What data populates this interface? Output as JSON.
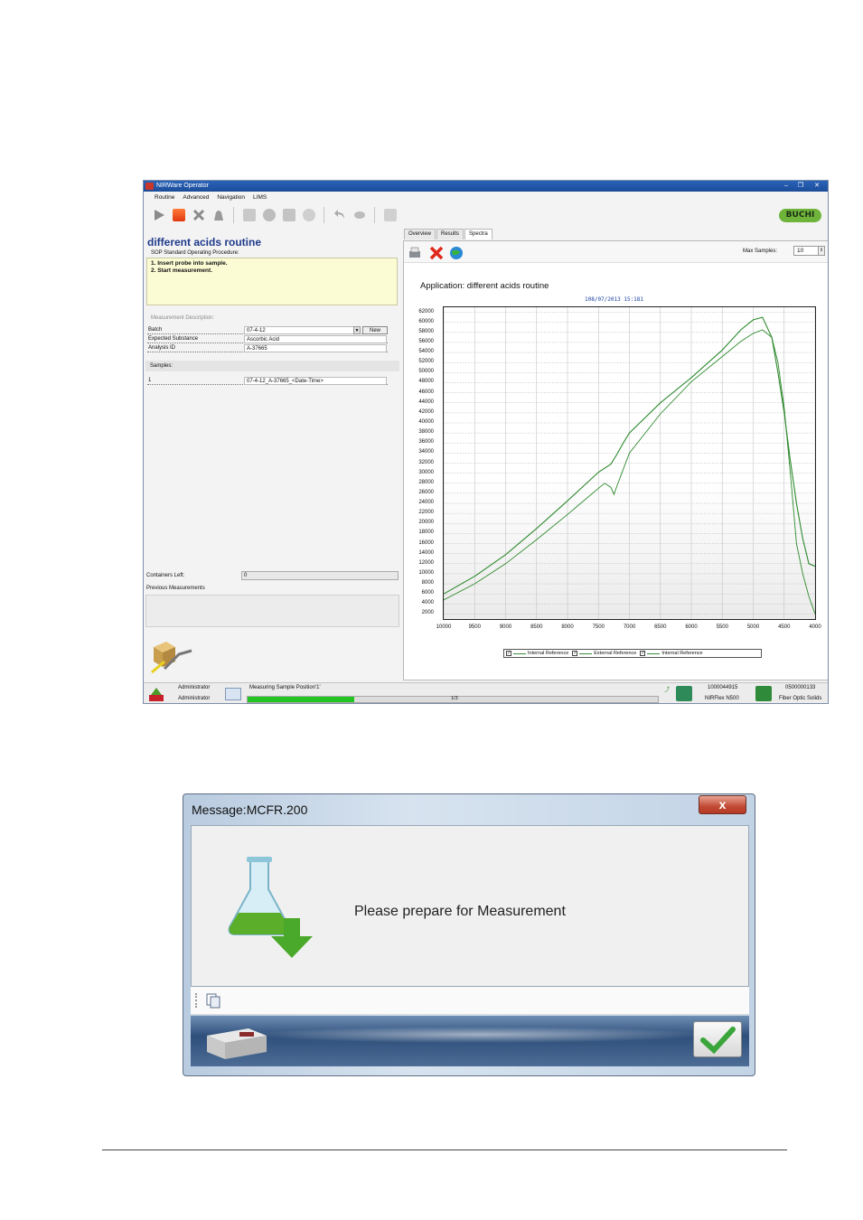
{
  "main_window": {
    "title": "NIRWare Operator",
    "menu": [
      "Routine",
      "Advanced",
      "Navigation",
      "LIMS"
    ],
    "logo_text": "BUCHI",
    "routine_title": "different acids routine",
    "sop_label": "SOP Standard Operating Procedure:",
    "sop_steps": [
      "1. Insert probe into sample.",
      "2. Start measurement."
    ],
    "measurement_description_label": "Measurement Description:",
    "fields": [
      {
        "label": "Batch",
        "value": "07-4-12"
      },
      {
        "label": "Expected Substance",
        "value": "Ascorbic Acid"
      },
      {
        "label": "Analysis ID",
        "value": "A-37665"
      }
    ],
    "new_button_label": "New",
    "samples_label": "Samples:",
    "sample_row": {
      "index": "1",
      "value": "07-4-12_A-37665_<Date-Time>"
    },
    "containers_left_label": "Containers Left:",
    "containers_left_value": "0",
    "previous_measurements_label": "Previous Measurements",
    "tabs": [
      "Overview",
      "Results",
      "Spectra"
    ],
    "active_tab": "Spectra",
    "max_samples_label": "Max Samples:",
    "max_samples_value": "10",
    "status": {
      "user_top": "Administrator",
      "user_bottom": "Administrator",
      "measuring_text": "Measuring Sample Position'1'",
      "progress_text": "1/3",
      "progress": 0.26,
      "device_id": "1000044915",
      "device_name": "NIRFlex N500",
      "cell_id": "0500000133",
      "cell_name": "Fiber Optic Solids"
    }
  },
  "chart_data": {
    "type": "line",
    "title": "Application: different acids routine",
    "subtitle": "108/07/2013 15:181",
    "x_ticks": [
      "10000",
      "9500",
      "9000",
      "8500",
      "8000",
      "7500",
      "7000",
      "6500",
      "6000",
      "5500",
      "5000",
      "4500",
      "4000"
    ],
    "y_ticks": [
      "62000",
      "60000",
      "58000",
      "56000",
      "54000",
      "52000",
      "50000",
      "48000",
      "46000",
      "44000",
      "42000",
      "40000",
      "38000",
      "36000",
      "34000",
      "32000",
      "30000",
      "28000",
      "26000",
      "24000",
      "22000",
      "20000",
      "18000",
      "16000",
      "14000",
      "12000",
      "10000",
      "8000",
      "6000",
      "4000",
      "2000"
    ],
    "xlim": [
      10000,
      4000
    ],
    "ylim": [
      1000,
      63000
    ],
    "series": [
      {
        "name": "Internal Reference",
        "x": [
          10000,
          9500,
          9000,
          8500,
          8000,
          7500,
          7300,
          7200,
          7100,
          7000,
          6500,
          6000,
          5500,
          5200,
          5000,
          4850,
          4700,
          4600,
          4500,
          4400,
          4300,
          4200,
          4100,
          4000
        ],
        "y": [
          6000,
          9500,
          13800,
          19000,
          24500,
          30200,
          31800,
          33800,
          36000,
          38000,
          44000,
          49000,
          54500,
          58500,
          60500,
          61000,
          57000,
          50000,
          42000,
          32500,
          24000,
          17000,
          12000,
          11500
        ]
      },
      {
        "name": "External Reference",
        "x": [
          10000,
          9500,
          9000,
          8500,
          8000,
          7500,
          7400,
          7300,
          7250,
          7200,
          7100,
          7000,
          6500,
          6000,
          5500,
          5200,
          5000,
          4850,
          4700,
          4600,
          4500,
          4400,
          4300,
          4200,
          4100,
          4000
        ],
        "y": [
          4800,
          8000,
          12000,
          16800,
          21800,
          27000,
          28000,
          27200,
          25800,
          27500,
          30800,
          34000,
          41800,
          48200,
          53200,
          56200,
          57800,
          58500,
          57000,
          52000,
          43000,
          30000,
          16000,
          10000,
          5500,
          2000
        ]
      }
    ],
    "legend_items": [
      "Internal Reference",
      "External Reference",
      "Internal Reference"
    ],
    "grid": true,
    "legend_position": "bottom"
  },
  "dialog": {
    "title": "Message:MCFR.200",
    "message": "Please prepare for Measurement",
    "close_label": "x"
  },
  "colors": {
    "accent_green": "#2f8a2f",
    "titlebar_blue": "#1b4c99",
    "buchi_green": "#6fb43a",
    "progress_green": "#22c422"
  }
}
